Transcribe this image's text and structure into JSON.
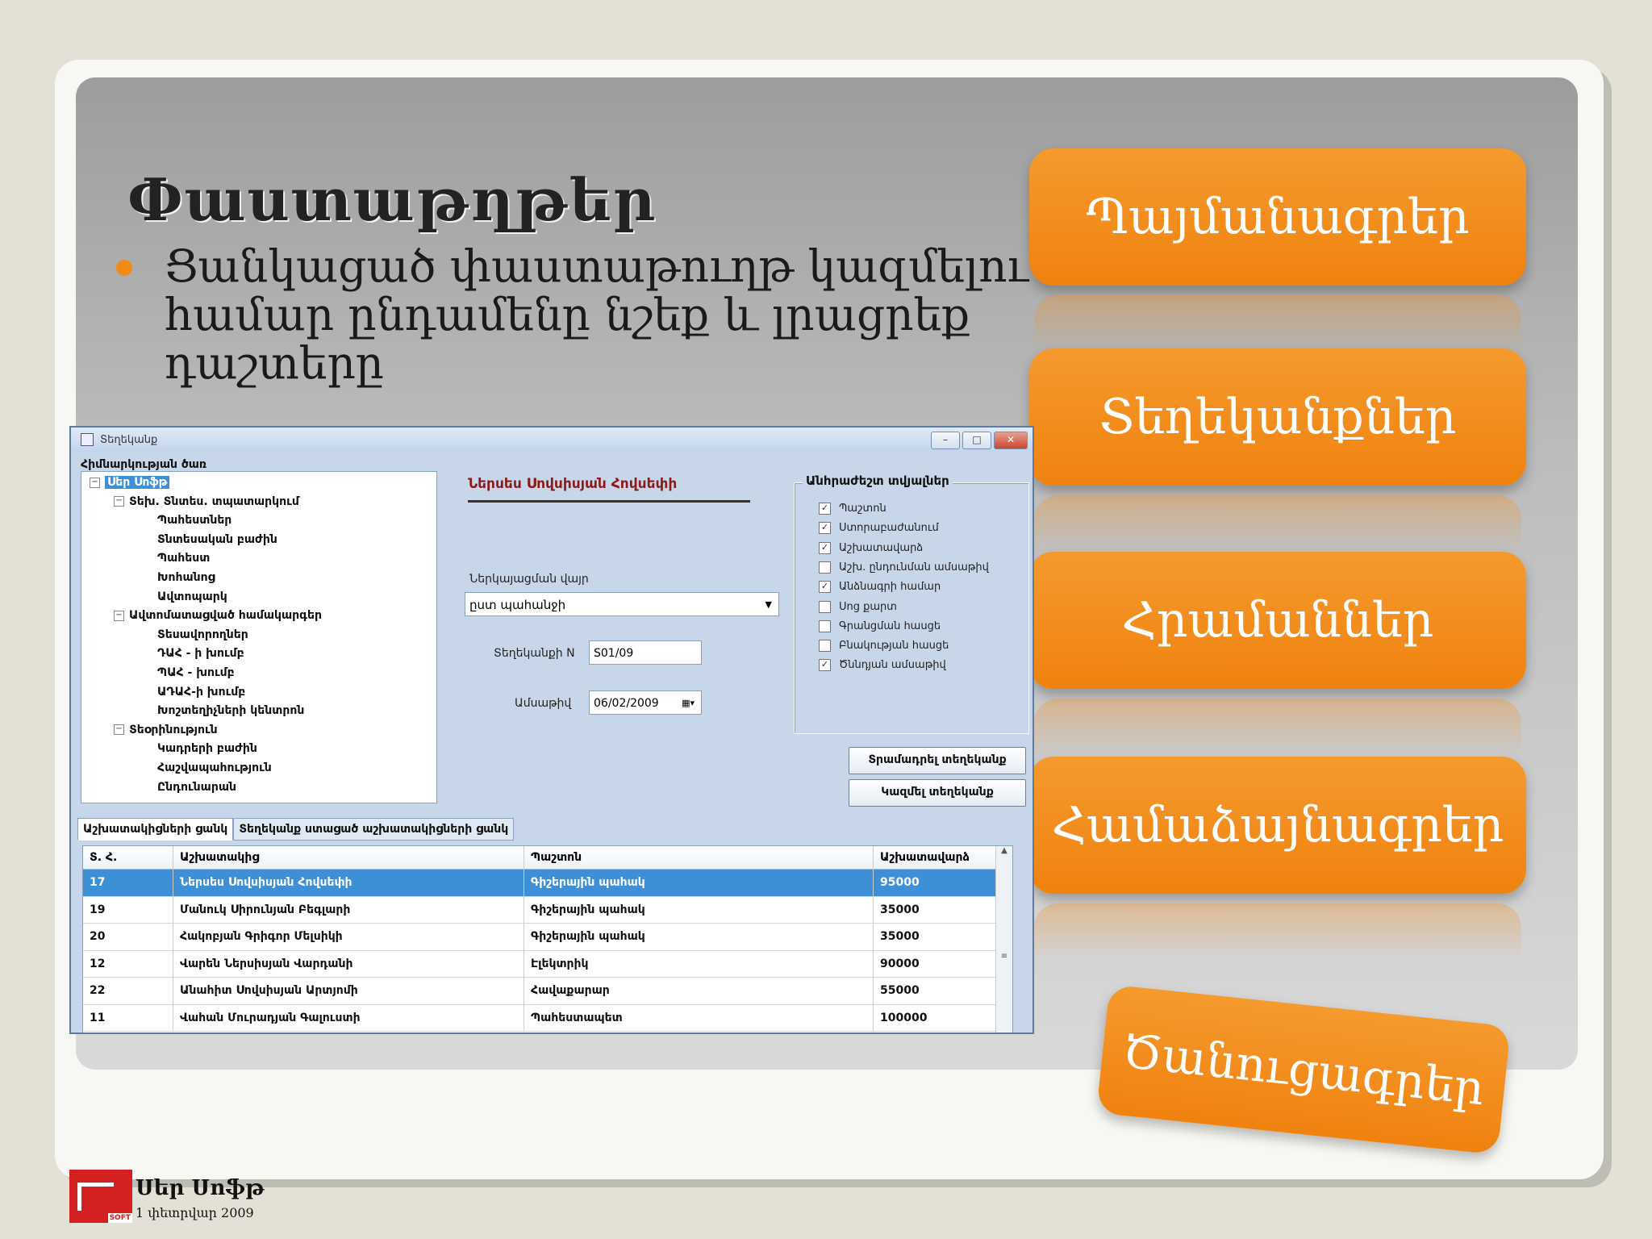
{
  "slide": {
    "title": "Փաստաթղթեր",
    "bullet": "Ցանկացած փաստաթուղթ կազմելու համար ընդամենը նշեք և լրացրեք դաշտերը"
  },
  "menu": {
    "items": [
      "Պայմանագրեր",
      "Տեղեկանքներ",
      "Հրամաններ",
      "Համաձայնագրեր",
      "Ծանուցագրեր"
    ]
  },
  "window": {
    "title": "Տեղեկանք",
    "tree_label": "Հիմնարկության ծառ",
    "tree": [
      {
        "label": "Սեր Սոֆթ",
        "level": 0,
        "toggle": "−",
        "selected": true
      },
      {
        "label": "Տեխ. Տնտես. տպատարկում",
        "level": 1,
        "toggle": "−"
      },
      {
        "label": "Պահեստներ",
        "level": 2
      },
      {
        "label": "Տնտեսական բաժին",
        "level": 2
      },
      {
        "label": "Պահեստ",
        "level": 2
      },
      {
        "label": "Խոհանոց",
        "level": 2
      },
      {
        "label": "Ավտոպարկ",
        "level": 2
      },
      {
        "label": "Ավտոմատացված համակարգեր",
        "level": 1,
        "toggle": "−"
      },
      {
        "label": "Տեսավորողներ",
        "level": 2
      },
      {
        "label": "ԴԱՀ - ի խումբ",
        "level": 2
      },
      {
        "label": "ՊԱՀ - խումբ",
        "level": 2
      },
      {
        "label": "ԱԴԱՀ-ի խումբ",
        "level": 2
      },
      {
        "label": "Խոշտեղիչների կենտրոն",
        "level": 2
      },
      {
        "label": "Տեօրինություն",
        "level": 1,
        "toggle": "−"
      },
      {
        "label": "Կադրերի բաժին",
        "level": 2
      },
      {
        "label": "Հաշվապահություն",
        "level": 2
      },
      {
        "label": "Ընդունարան",
        "level": 2
      }
    ],
    "employee_name": "Ներսես Սովսիսյան Հովսեփի",
    "format_label": "Ներկայացման վայր",
    "format_value": "ըստ պահանջի",
    "number_label": "Տեղեկանքի N",
    "number_value": "S01/09",
    "date_label": "Ամսաթիվ",
    "date_value": "06/02/2009",
    "required_label": "Անհրաժեշտ տվյալներ",
    "checks": [
      {
        "label": "Պաշտոն",
        "checked": true
      },
      {
        "label": "Ստորաբաժանում",
        "checked": true
      },
      {
        "label": "Աշխատավարձ",
        "checked": true
      },
      {
        "label": "Աշխ. ընդունման ամսաթիվ",
        "checked": false
      },
      {
        "label": "Անձնագրի համար",
        "checked": true
      },
      {
        "label": "Սոց քարտ",
        "checked": false
      },
      {
        "label": "Գրանցման հասցե",
        "checked": false
      },
      {
        "label": "Բնակության հասցե",
        "checked": false
      },
      {
        "label": "Ծննդյան ամսաթիվ",
        "checked": true
      }
    ],
    "print_button": "Տրամադրել տեղեկանք",
    "create_button": "Կազմել տեղեկանք",
    "tabs": [
      "Աշխատակիցների ցանկ",
      "Տեղեկանք ստացած աշխատակիցների ցանկ"
    ],
    "columns": [
      "Տ. Հ.",
      "Աշխատակից",
      "Պաշտոն",
      "Աշխատավարձ"
    ],
    "rows": [
      [
        "17",
        "Ներսես Սովսիսյան Հովսեփի",
        "Գիշերային պահակ",
        "95000"
      ],
      [
        "19",
        "Մանուկ Սիրունյան Բեգլարի",
        "Գիշերային պահակ",
        "35000"
      ],
      [
        "20",
        "Հակոբյան Գրիգոր Մելսիկի",
        "Գիշերային պահակ",
        "35000"
      ],
      [
        "12",
        "Վարեն Ներսիսյան Վարդանի",
        "Էլեկտրիկ",
        "90000"
      ],
      [
        "22",
        "Անահիտ Սովսիսյան Արտյոմի",
        "Հավաքարար",
        "55000"
      ],
      [
        "11",
        "Վահան Մուրադյան Գալուստի",
        "Պահեստապետ",
        "100000"
      ]
    ]
  },
  "footer": {
    "brand": "Սեր Սոֆթ",
    "date": "1 փետրվար 2009",
    "logo_text": "SOFT"
  }
}
